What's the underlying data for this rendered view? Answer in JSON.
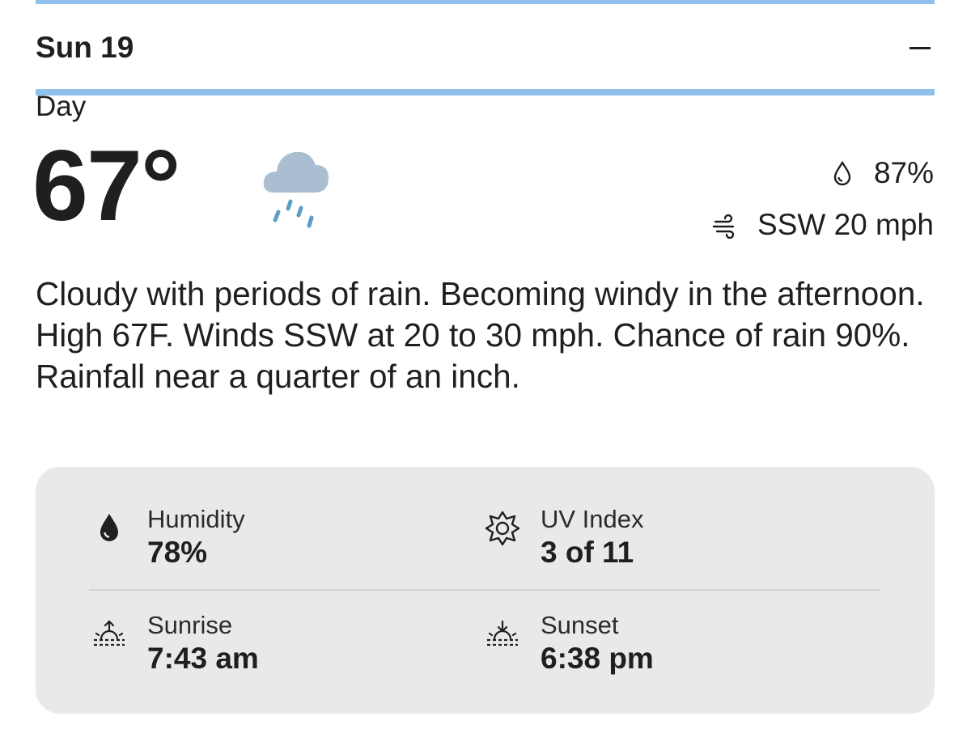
{
  "header": {
    "day_title": "Sun 19",
    "collapse_icon": "minus-icon"
  },
  "day": {
    "period_label": "Day",
    "temperature": "67°",
    "condition_icon": "rain-cloud-icon",
    "precip_chance": "87%",
    "wind": "SSW 20 mph",
    "summary": "Cloudy with periods of rain. Becoming windy in the afternoon. High 67F. Winds SSW at 20 to 30 mph. Chance of rain 90%. Rainfall near a quarter of an inch."
  },
  "details": {
    "humidity": {
      "label": "Humidity",
      "value": "78%",
      "icon": "water-drop-icon"
    },
    "uv": {
      "label": "UV Index",
      "value": "3 of 11",
      "icon": "uv-sun-icon"
    },
    "sunrise": {
      "label": "Sunrise",
      "value": "7:43 am",
      "icon": "sunrise-icon"
    },
    "sunset": {
      "label": "Sunset",
      "value": "6:38 pm",
      "icon": "sunset-icon"
    }
  },
  "colors": {
    "accent_rule": "#8fc1ec",
    "cloud": "#a9bfd1",
    "rain": "#5a9ec7",
    "card_bg": "#e9e9e9",
    "text": "#1f1f1f"
  }
}
